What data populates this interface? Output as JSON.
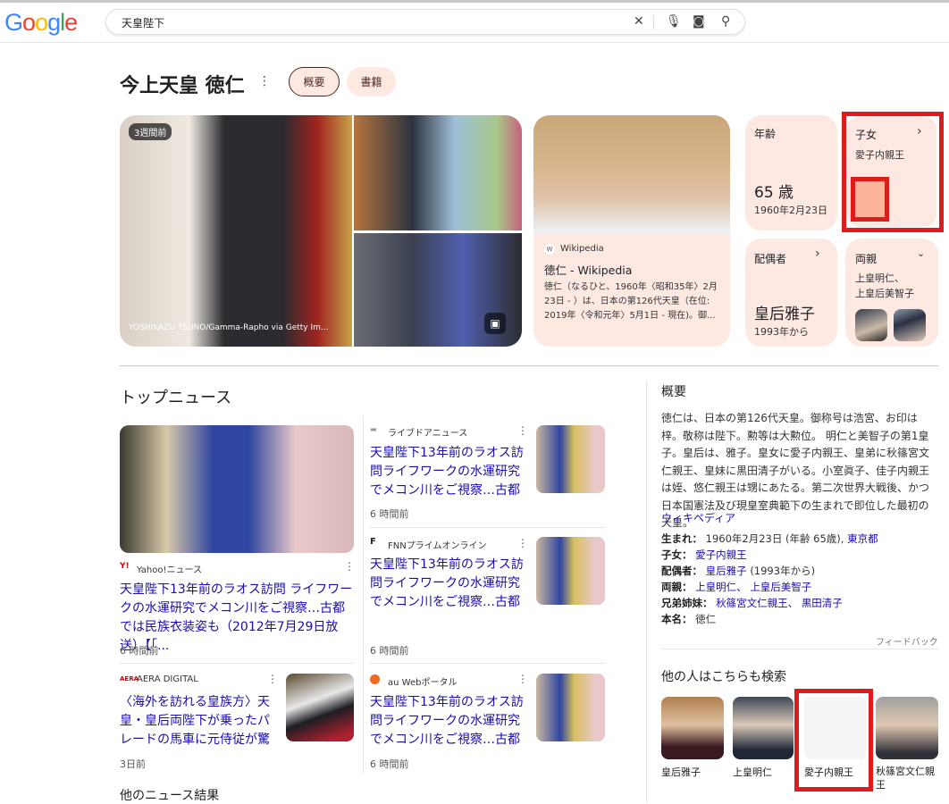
{
  "header": {
    "logo": "Google",
    "query": "天皇陛下",
    "icons": [
      "close-icon",
      "mic-icon",
      "lens-icon",
      "search-icon"
    ]
  },
  "entity": {
    "title": "今上天皇 徳仁",
    "tabs": [
      {
        "label": "概要",
        "active": true
      },
      {
        "label": "書籍",
        "active": false
      }
    ]
  },
  "images": {
    "badge": "3週間前",
    "credit": "YOSHIKAZU TSUNO/Gamma-Rapho via Getty Im..."
  },
  "wiki_card": {
    "source": "Wikipedia",
    "title": "徳仁 - Wikipedia",
    "snippet": "徳仁（なるひと、1960年〈昭和35年〉2月23日 - ）は、日本の第126代天皇（在位: 2019年〈令和元年〉5月1日 - 現在)。御..."
  },
  "cards": {
    "age": {
      "label": "年齢",
      "value": "65 歳",
      "sub": "1960年2月23日"
    },
    "children": {
      "label": "子女",
      "value": "愛子内親王"
    },
    "spouse": {
      "label": "配偶者",
      "value": "皇后雅子",
      "sub": "1993年から"
    },
    "parents": {
      "label": "両親",
      "value1": "上皇明仁、",
      "value2": "上皇后美智子"
    }
  },
  "news": {
    "heading": "トップニュース",
    "items": [
      {
        "source": "Yahoo!ニュース",
        "title": "天皇陛下13年前のラオス訪問 ライフワークの水運研究でメコン川をご視察…古都では民族衣装姿も（2012年7月29日放送）【「...",
        "time": "6 時間前"
      },
      {
        "source": "ライブドアニュース",
        "title": "天皇陛下13年前のラオス訪問ライフワークの水運研究でメコン川をご視察…古都では...",
        "time": "6 時間前"
      },
      {
        "source": "FNNプライムオンライン",
        "title": "天皇陛下13年前のラオス訪問ライフワークの水運研究でメコン川をご視察…古都では...",
        "time": "6 時間前"
      },
      {
        "source": "AERA DIGITAL",
        "title": "〈海外を訪れる皇族方〉天皇・皇后両陛下が乗ったパレードの馬車に元侍従が驚い...",
        "time": "3日前"
      },
      {
        "source": "au Webポータル",
        "title": "天皇陛下13年前のラオス訪問ライフワークの水運研究でメコン川をご視察…古都では...",
        "time": "6 時間前"
      }
    ],
    "more": "他のニュース結果"
  },
  "overview": {
    "heading": "概要",
    "text": "徳仁は、日本の第126代天皇。御称号は浩宮、お印は梓。敬称は陛下。勲等は大勲位。 明仁と美智子の第1皇子。皇后は、雅子。皇女に愛子内親王、皇弟に秋篠宮文仁親王、皇妹に黒田清子がいる。小室眞子、佳子内親王は姪、悠仁親王は甥にあたる。第二次世界大戦後、かつ日本国憲法及び現皇室典範下の生まれで即位した最初の天皇。",
    "source_link": "ウィキペディア",
    "facts": {
      "born_label": "生まれ：",
      "born": "1960年2月23日 (年齢 65歳),",
      "born_place": "東京都",
      "children_label": "子女：",
      "children": "愛子内親王",
      "spouse_label": "配偶者：",
      "spouse": "皇后雅子",
      "spouse_since": "(1993年から)",
      "parents_label": "両親：",
      "parent1": "上皇明仁、",
      "parent2": "上皇后美智子",
      "siblings_label": "兄弟姉妹：",
      "sibling1": "秋篠宮文仁親王、",
      "sibling2": "黒田清子",
      "realname_label": "本名：",
      "realname": "徳仁"
    },
    "feedback": "フィードバック"
  },
  "people_also": {
    "heading": "他の人はこちらも検索",
    "items": [
      "皇后雅子",
      "上皇明仁",
      "愛子内親王",
      "秋篠宮文仁親王"
    ]
  }
}
